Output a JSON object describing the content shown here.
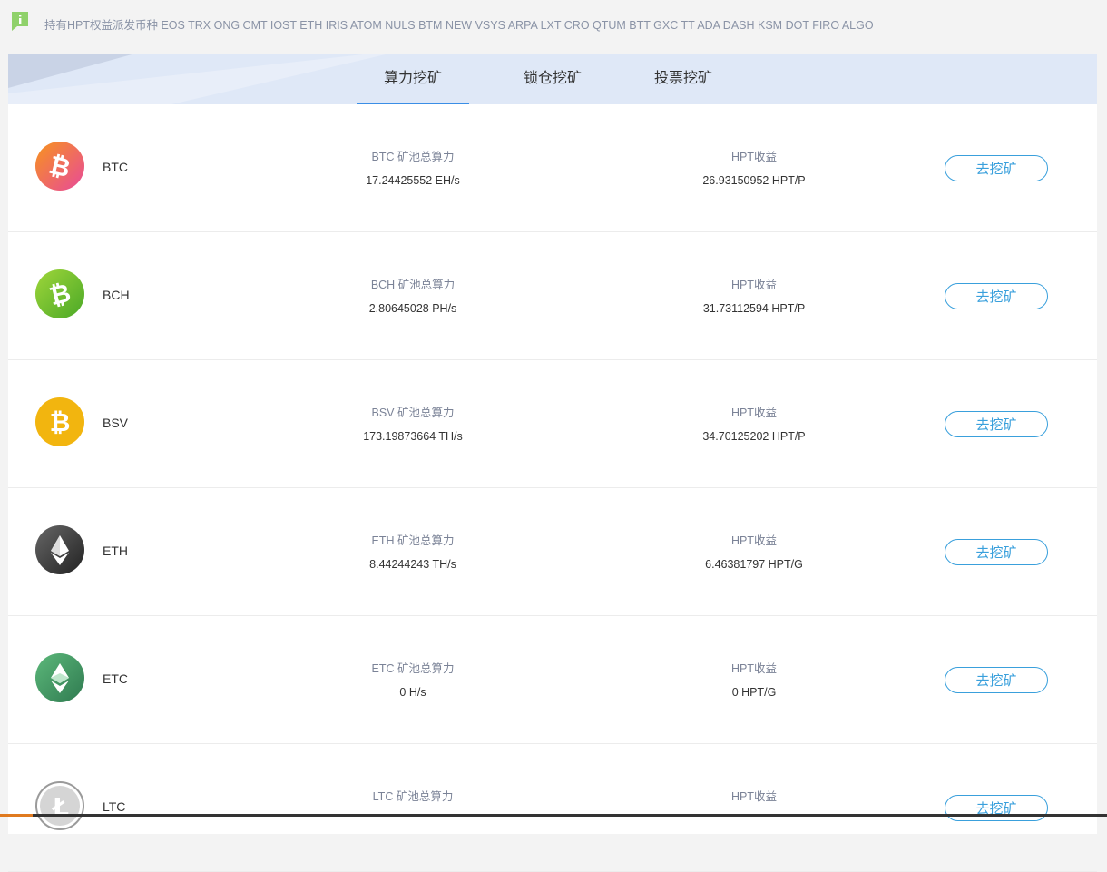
{
  "notice": {
    "icon": "info-bubble-icon",
    "text": "持有HPT权益派发币种 EOS TRX ONG CMT IOST ETH IRIS ATOM NULS BTM NEW VSYS ARPA LXT CRO QTUM BTT GXC TT ADA DASH KSM DOT FIRO ALGO"
  },
  "tabs": [
    {
      "label": "算力挖矿",
      "active": true
    },
    {
      "label": "锁仓挖矿",
      "active": false
    },
    {
      "label": "投票挖矿",
      "active": false
    }
  ],
  "colors": {
    "accent": "#3aa0dc",
    "tab_underline": "#3a8ee6"
  },
  "coins": [
    {
      "name": "BTC",
      "icon": "bitcoin-icon",
      "hash_label": "BTC 矿池总算力",
      "hash_value": "17.24425552 EH/s",
      "reward_label": "HPT收益",
      "reward_value": "26.93150952 HPT/P",
      "button": "去挖矿"
    },
    {
      "name": "BCH",
      "icon": "bitcoin-cash-icon",
      "hash_label": "BCH 矿池总算力",
      "hash_value": "2.80645028 PH/s",
      "reward_label": "HPT收益",
      "reward_value": "31.73112594 HPT/P",
      "button": "去挖矿"
    },
    {
      "name": "BSV",
      "icon": "bitcoin-sv-icon",
      "hash_label": "BSV 矿池总算力",
      "hash_value": "173.19873664 TH/s",
      "reward_label": "HPT收益",
      "reward_value": "34.70125202 HPT/P",
      "button": "去挖矿"
    },
    {
      "name": "ETH",
      "icon": "ethereum-icon",
      "hash_label": "ETH 矿池总算力",
      "hash_value": "8.44244243 TH/s",
      "reward_label": "HPT收益",
      "reward_value": "6.46381797 HPT/G",
      "button": "去挖矿"
    },
    {
      "name": "ETC",
      "icon": "ethereum-classic-icon",
      "hash_label": "ETC 矿池总算力",
      "hash_value": "0 H/s",
      "reward_label": "HPT收益",
      "reward_value": "0 HPT/G",
      "button": "去挖矿"
    },
    {
      "name": "LTC",
      "icon": "litecoin-icon",
      "hash_label": "LTC 矿池总算力",
      "hash_value": "",
      "reward_label": "HPT收益",
      "reward_value": "",
      "button": "去挖矿"
    }
  ]
}
